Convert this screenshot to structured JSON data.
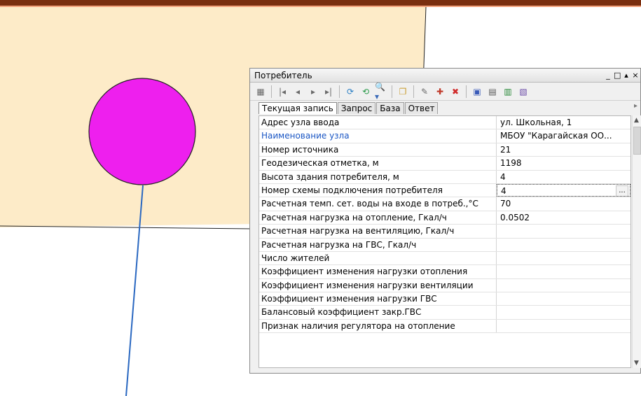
{
  "panel": {
    "title": "Потребитель",
    "window_buttons": [
      "_",
      "□",
      "▴",
      "×"
    ],
    "tabs": [
      "Текущая запись",
      "Запрос",
      "База",
      "Ответ"
    ],
    "rows": [
      {
        "name": "Адрес узла ввода",
        "value": "ул. Школьная, 1"
      },
      {
        "name": "Наименование узла",
        "value": "МБОУ \"Карагайская ОО..."
      },
      {
        "name": "Номер источника",
        "value": "21"
      },
      {
        "name": "Геодезическая отметка, м",
        "value": "1198"
      },
      {
        "name": "Высота здания потребителя, м",
        "value": "4"
      },
      {
        "name": "Номер схемы подключения потребителя",
        "value": "4"
      },
      {
        "name": "Расчетная темп. сет. воды на входе в потреб.,°С",
        "value": "70"
      },
      {
        "name": "Расчетная нагрузка на отопление, Гкал/ч",
        "value": "0.0502"
      },
      {
        "name": "Расчетная нагрузка на вентиляцию, Гкал/ч",
        "value": ""
      },
      {
        "name": "Расчетная нагрузка на ГВС, Гкал/ч",
        "value": ""
      },
      {
        "name": "Число жителей",
        "value": ""
      },
      {
        "name": "Коэффициент изменения нагрузки отопления",
        "value": ""
      },
      {
        "name": "Коэффициент изменения нагрузки вентиляции",
        "value": ""
      },
      {
        "name": "Коэффициент изменения нагрузки ГВС",
        "value": ""
      },
      {
        "name": "Балансовый коэффициент закр.ГВС",
        "value": ""
      },
      {
        "name": "Признак наличия регулятора на отопление",
        "value": ""
      }
    ],
    "ellipsis": "..."
  },
  "colors": {
    "map_area": "#fdebc8",
    "consumer_node": "#ee1fee",
    "pipe_line": "#2a68c1",
    "top_bar": "#7a2f10"
  }
}
